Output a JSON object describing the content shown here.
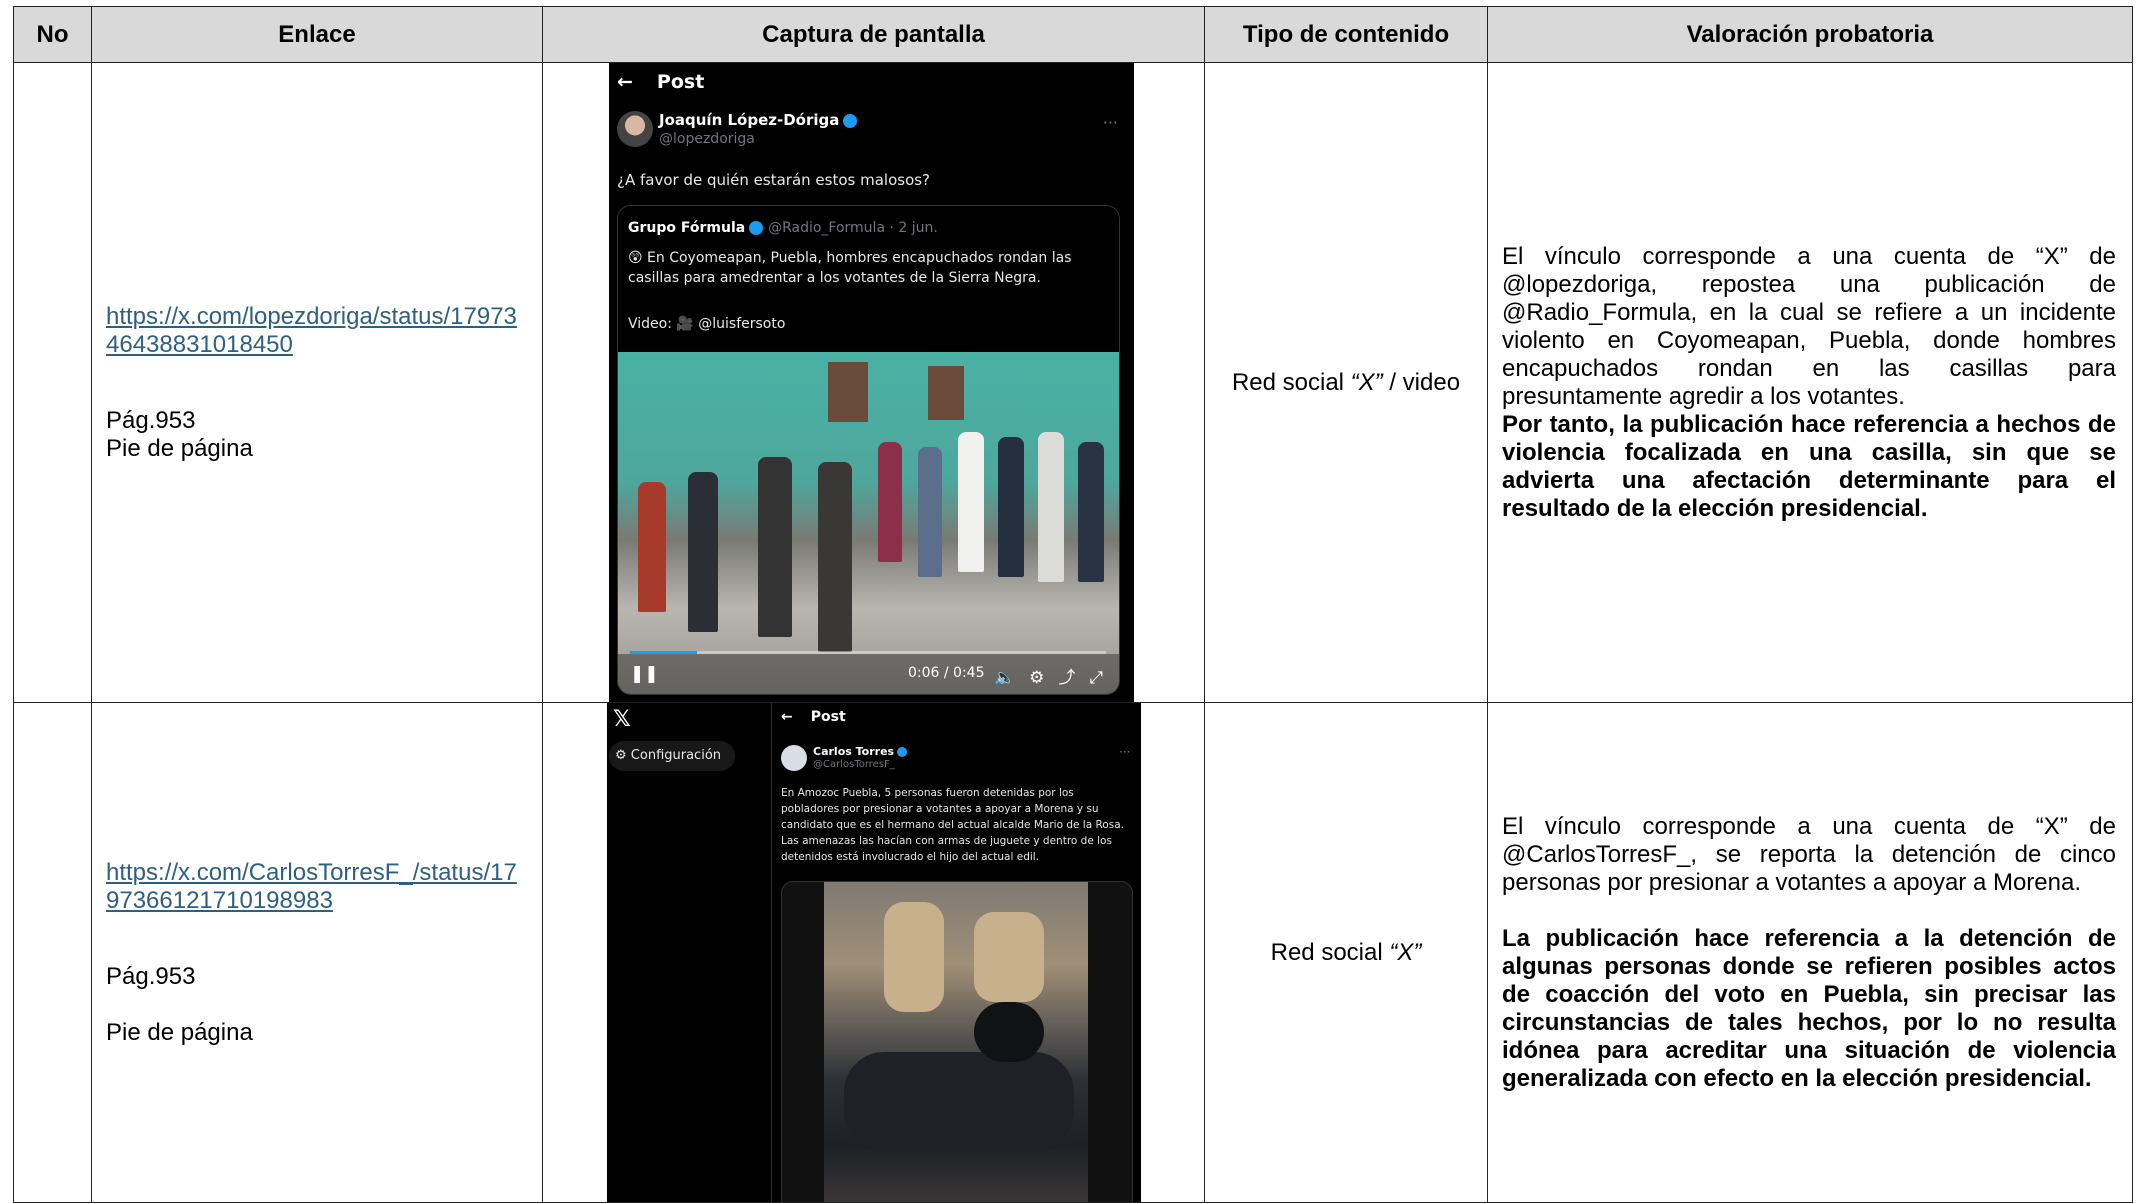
{
  "table": {
    "headers": [
      "No",
      "Enlace",
      "Captura de pantalla",
      "Tipo de contenido",
      "Valoración probatoria"
    ],
    "rows": [
      {
        "no": "",
        "link": "https://x.com/lopezdoriga/status/1797346438831018450",
        "pag": "Pág.953",
        "footer": "Pie de página",
        "type_prefix": "Red social ",
        "type_italic": "“X”",
        "type_suffix": " / video",
        "valuation_plain": "El vínculo corresponde a una cuenta de “X” de @lopezdoriga, repostea una publicación de @Radio_Formula, en la cual se refiere a un incidente violento en Coyomeapan, Puebla, donde hombres encapuchados rondan en las casillas para presuntamente agredir a los votantes.",
        "valuation_bold": "Por tanto, la publicación hace referencia a hechos de violencia focalizada en una casilla, sin que se advierta una afectación determinante para el resultado de la elección presidencial.",
        "screenshot": {
          "back_icon": "←",
          "title": "Post",
          "author": "Joaquín López-Dóriga",
          "handle": "@lopezdoriga",
          "more": "···",
          "text": "¿A favor de quién estarán estos malosos?",
          "quote_author": "Grupo Fórmula",
          "quote_handle": "@Radio_Formula · 2 jun.",
          "quote_text": "😲 En Coyomeapan, Puebla, hombres encapuchados rondan las casillas para amedrentar a los votantes de la Sierra Negra.",
          "quote_video": "Video: 🎥 @luisfersoto",
          "pause_icon": "❚❚",
          "time": "0:06 / 0:45",
          "progress": 0.14,
          "control_icons": "🔈⚙⤴⤢"
        }
      },
      {
        "no": "",
        "link": "https://x.com/CarlosTorresF_/status/1797366121710198983",
        "pag": "Pág.953",
        "footer": "Pie de página",
        "type_prefix": "Red social ",
        "type_italic": "“X”",
        "type_suffix": "",
        "valuation_plain": "El vínculo corresponde a una cuenta de “X” de @CarlosTorresF_, se reporta la detención de cinco personas por presionar a votantes a apoyar a Morena.",
        "valuation_bold": "La publicación hace referencia a la detención de algunas personas donde se refieren posibles actos de coacción del voto en Puebla, sin precisar las circunstancias de tales hechos, por lo no resulta idónea para acreditar una situación de violencia generalizada con efecto en la elección presidencial.",
        "screenshot": {
          "x_logo": "𝕏",
          "config": "Configuración",
          "back_icon": "←",
          "title": "Post",
          "author": "Carlos Torres",
          "handle": "@CarlosTorresF_",
          "more": "···",
          "text1": "En Amozoc Puebla, 5 personas fueron detenidas por los pobladores por presionar a votantes a apoyar a Morena y su candidato que es el hermano del actual alcalde Mario de la Rosa.",
          "text2": "Las amenazas las hacían con armas de juguete y dentro de los detenidos está involucrado el hijo del actual edil."
        }
      }
    ]
  }
}
